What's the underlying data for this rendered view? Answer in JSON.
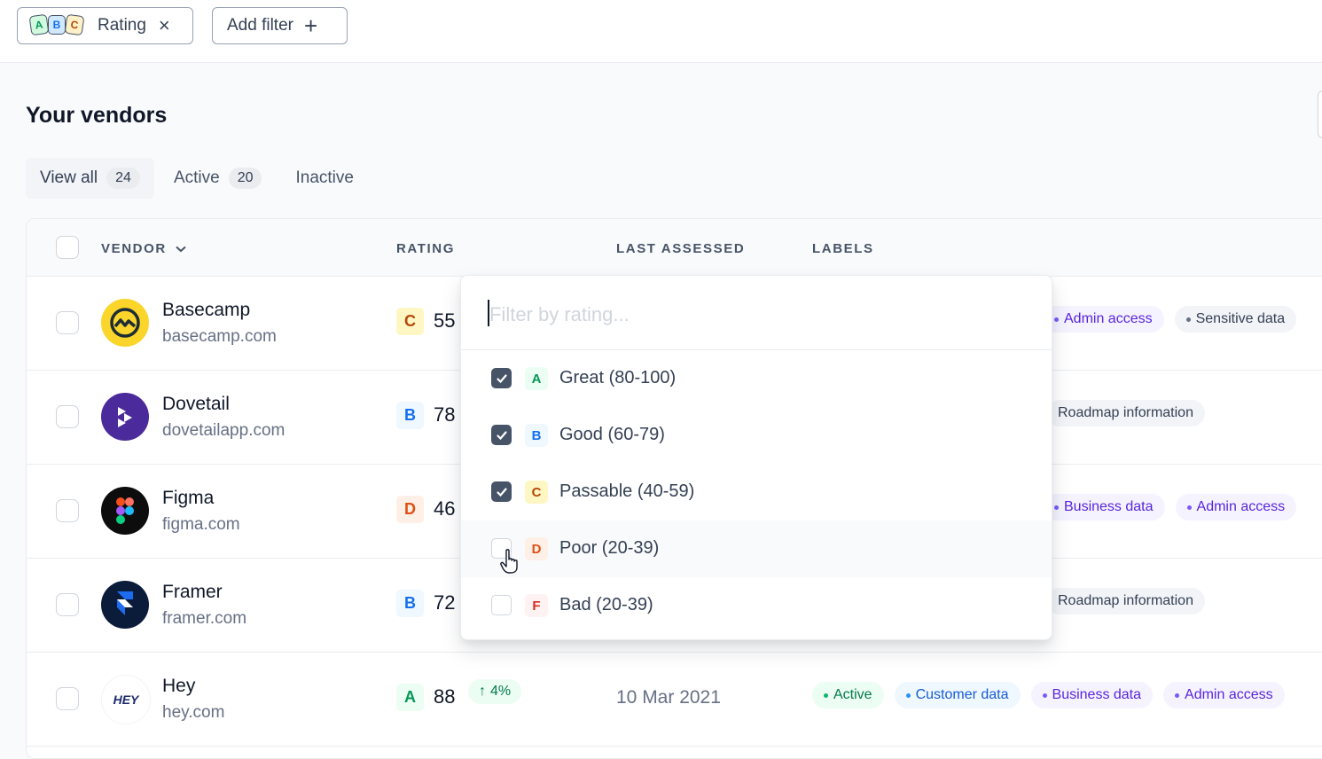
{
  "filters": {
    "rating_chip": {
      "icon_letters": [
        "A",
        "B",
        "C"
      ],
      "label": "Rating",
      "close_icon": "×"
    },
    "add_filter": {
      "label": "Add filter",
      "icon": "+"
    }
  },
  "page": {
    "title": "Your vendors"
  },
  "tabs": [
    {
      "label": "View all",
      "count": "24"
    },
    {
      "label": "Active",
      "count": "20"
    },
    {
      "label": "Inactive"
    }
  ],
  "table": {
    "columns": {
      "vendor": "VENDOR",
      "rating": "RATING",
      "last_assessed": "LAST ASSESSED",
      "labels": "LABELS"
    },
    "rows": [
      {
        "name": "Basecamp",
        "domain": "basecamp.com",
        "grade": "C",
        "score": "55",
        "labels": [
          "Admin access",
          "Sensitive data"
        ]
      },
      {
        "name": "Dovetail",
        "domain": "dovetailapp.com",
        "grade": "B",
        "score": "78",
        "labels": [
          "Roadmap information"
        ]
      },
      {
        "name": "Figma",
        "domain": "figma.com",
        "grade": "D",
        "score": "46",
        "labels": [
          "Business data",
          "Admin access"
        ]
      },
      {
        "name": "Framer",
        "domain": "framer.com",
        "grade": "B",
        "score": "72",
        "labels": [
          "Roadmap information"
        ]
      },
      {
        "name": "Hey",
        "domain": "hey.com",
        "grade": "A",
        "score": "88",
        "trend": "4%",
        "trend_arrow": "↑",
        "last_assessed": "10 Mar 2021",
        "labels": [
          "Active",
          "Customer data",
          "Business data",
          "Admin access"
        ],
        "logo_text": "HEY"
      }
    ]
  },
  "dropdown": {
    "placeholder": "Filter by rating...",
    "options": [
      {
        "grade": "A",
        "label": "Great (80-100)",
        "checked": true
      },
      {
        "grade": "B",
        "label": "Good (60-79)",
        "checked": true
      },
      {
        "grade": "C",
        "label": "Passable (40-59)",
        "checked": true
      },
      {
        "grade": "D",
        "label": "Poor (20-39)",
        "checked": false
      },
      {
        "grade": "F",
        "label": "Bad (20-39)",
        "checked": false
      }
    ]
  },
  "colors": {
    "accent": "#475467",
    "grade_A": "#039855",
    "grade_B": "#1570ef",
    "grade_C": "#b54708",
    "grade_D": "#e04f16"
  }
}
